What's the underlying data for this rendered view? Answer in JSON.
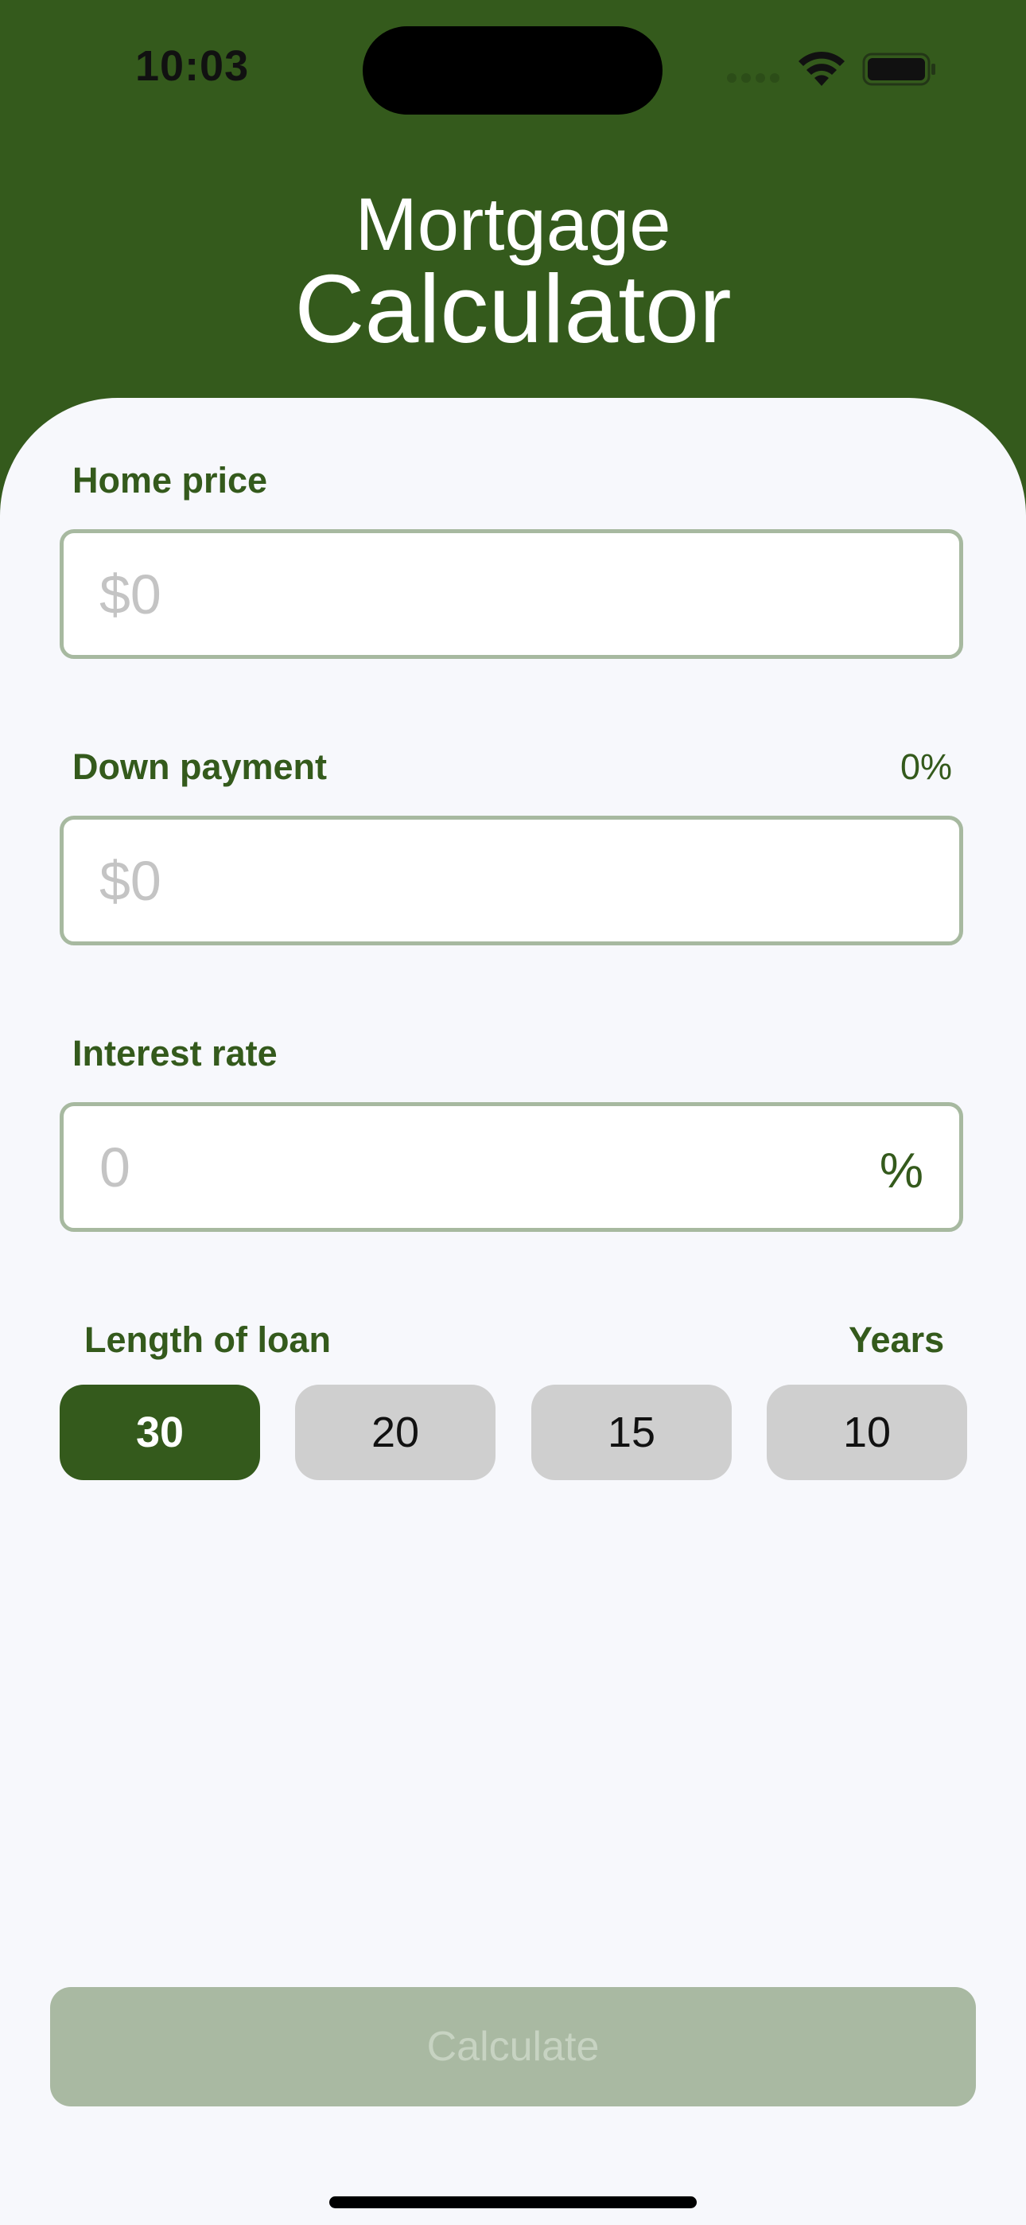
{
  "status_bar": {
    "time": "10:03"
  },
  "header": {
    "title_line1": "Mortgage",
    "title_line2": "Calculator"
  },
  "form": {
    "home_price": {
      "label": "Home price",
      "value": "",
      "placeholder": "$0"
    },
    "down_payment": {
      "label": "Down payment",
      "percent": "0%",
      "value": "",
      "placeholder": "$0"
    },
    "interest_rate": {
      "label": "Interest rate",
      "value": "",
      "placeholder": "0",
      "suffix": "%"
    },
    "loan_length": {
      "label": "Length of loan",
      "unit": "Years",
      "options": [
        "30",
        "20",
        "15",
        "10"
      ],
      "selected": "30"
    }
  },
  "actions": {
    "calculate_label": "Calculate",
    "calculate_enabled": false
  },
  "colors": {
    "brand_green": "#345a1c",
    "card_background": "#f7f8fc",
    "input_border": "#a7b9a0",
    "placeholder": "#c4c4c4",
    "option_unselected": "#cfcfcf",
    "button_disabled": "#a9b9a2"
  },
  "icons": {
    "signal": "cellular-signal-icon",
    "wifi": "wifi-icon",
    "battery": "battery-icon"
  }
}
